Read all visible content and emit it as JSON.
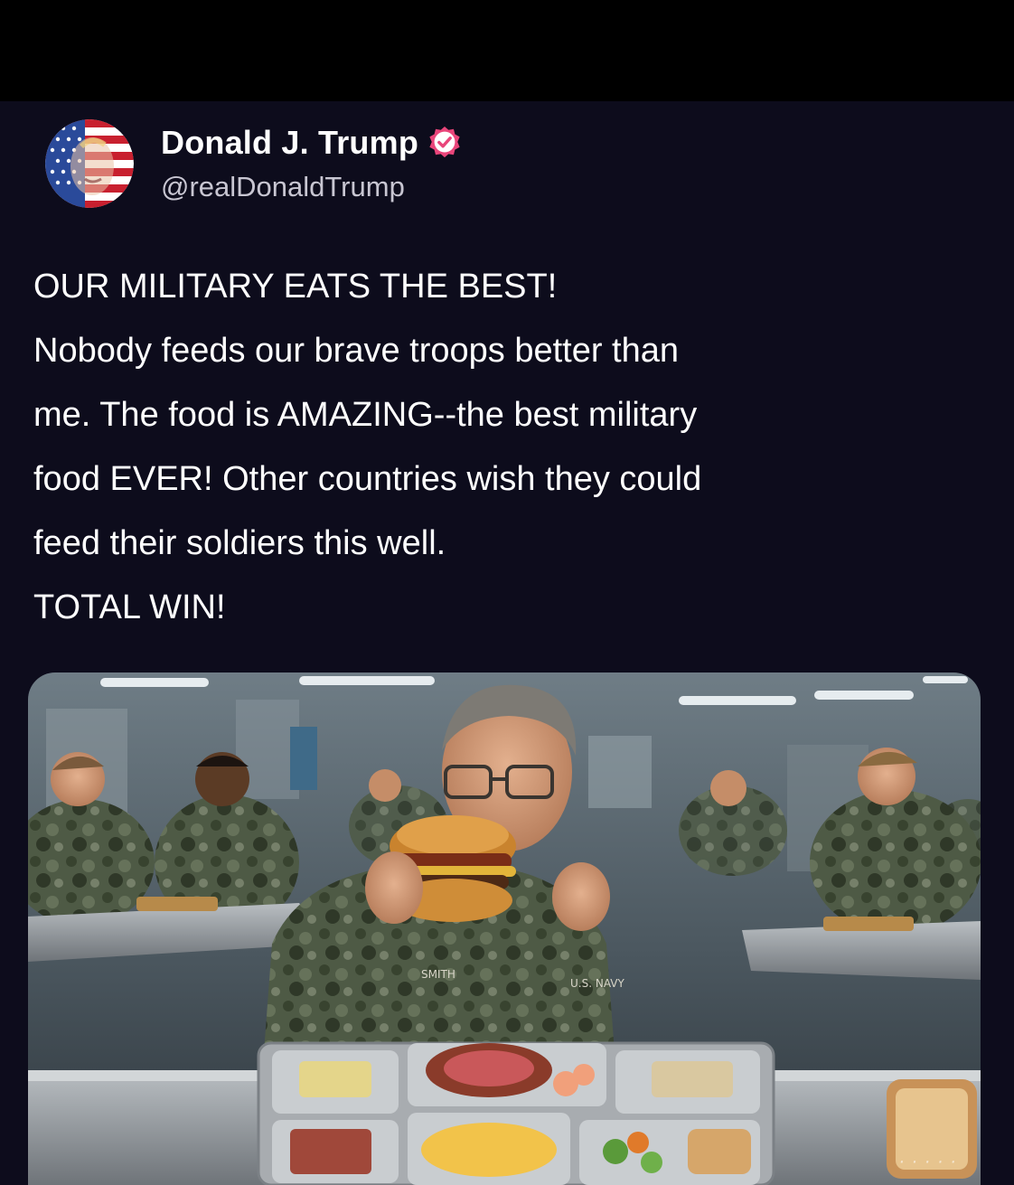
{
  "post": {
    "author": {
      "display_name": "Donald J. Trump",
      "handle": "@realDonaldTrump",
      "verified": true,
      "avatar_icon": "flag-portrait-avatar",
      "verified_icon": "verified-badge-icon"
    },
    "text_lines": [
      "OUR MILITARY EATS THE BEST!",
      "Nobody feeds our brave troops better than",
      "me. The food is AMAZING--the best military",
      "food EVER! Other countries wish they could",
      "feed their soldiers this well.",
      "TOTAL WIN!"
    ],
    "image": {
      "badge_name": "SMITH",
      "badge_navy": "U.S. NAVY"
    }
  },
  "colors": {
    "background": "#0d0c1c",
    "verified_badge": "#e9457a",
    "text": "#ffffff",
    "handle": "#c8c6d2"
  }
}
